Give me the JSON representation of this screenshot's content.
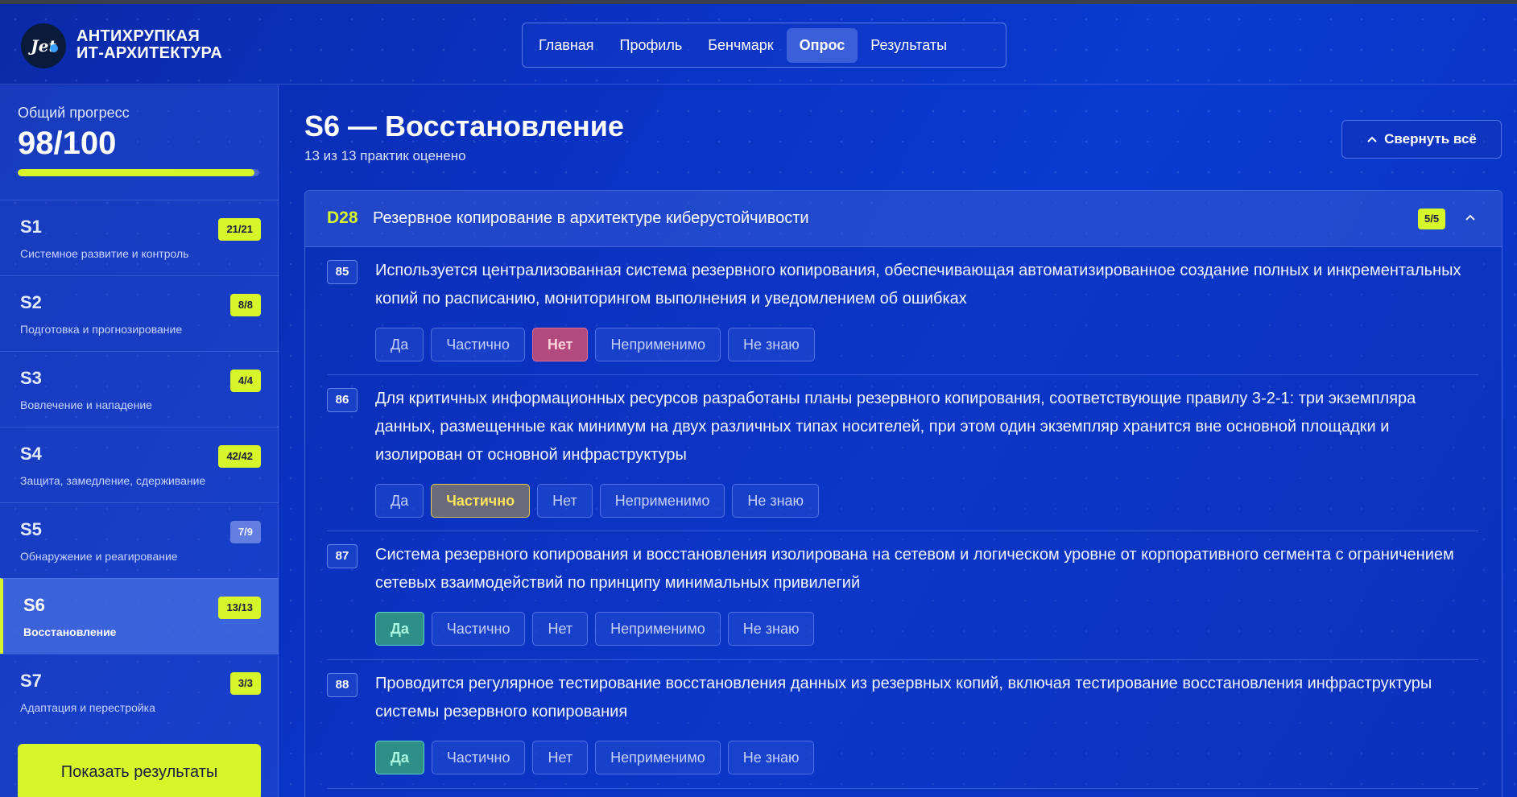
{
  "brand": {
    "logo_text": "Jet",
    "line1": "АНТИХРУПКАЯ",
    "line2": "ИТ-АРХИТЕКТУРА"
  },
  "nav": {
    "items": [
      {
        "label": "Главная",
        "active": false
      },
      {
        "label": "Профиль",
        "active": false
      },
      {
        "label": "Бенчмарк",
        "active": false
      },
      {
        "label": "Опрос",
        "active": true
      },
      {
        "label": "Результаты",
        "active": false
      }
    ]
  },
  "sidebar": {
    "progress_label": "Общий прогресс",
    "progress_value": "98/100",
    "progress_fraction": 0.98,
    "sections": [
      {
        "code": "S1",
        "name": "Системное развитие и контроль",
        "badge": "21/21",
        "complete": true,
        "active": false
      },
      {
        "code": "S2",
        "name": "Подготовка и прогнозирование",
        "badge": "8/8",
        "complete": true,
        "active": false
      },
      {
        "code": "S3",
        "name": "Вовлечение и нападение",
        "badge": "4/4",
        "complete": true,
        "active": false
      },
      {
        "code": "S4",
        "name": "Защита, замедление, сдерживание",
        "badge": "42/42",
        "complete": true,
        "active": false
      },
      {
        "code": "S5",
        "name": "Обнаружение и реагирование",
        "badge": "7/9",
        "complete": false,
        "active": false
      },
      {
        "code": "S6",
        "name": "Восстановление",
        "badge": "13/13",
        "complete": true,
        "active": true
      },
      {
        "code": "S7",
        "name": "Адаптация и перестройка",
        "badge": "3/3",
        "complete": true,
        "active": false
      }
    ],
    "show_results_label": "Показать результаты"
  },
  "main": {
    "title": "S6 — Восстановление",
    "subtitle": "13 из 13 практик оценено",
    "collapse_label": "Свернуть всё",
    "card": {
      "code": "D28",
      "title": "Резервное копирование в архитектуре киберустойчивости",
      "badge": "5/5",
      "option_labels": [
        "Да",
        "Частично",
        "Нет",
        "Неприменимо",
        "Не знаю"
      ],
      "questions": [
        {
          "num": "85",
          "text": "Используется централизованная система резервного копирования, обеспечивающая автоматизированное создание полных и инкрементальных копий по расписанию, мониторингом выполнения и уведомлением об ошибках",
          "selected": "Нет"
        },
        {
          "num": "86",
          "text": "Для критичных информационных ресурсов разработаны планы резервного копирования, соответствующие правилу 3-2-1: три экземпляра данных, размещенные как минимум на двух различных типах носителей, при этом один экземпляр хранится вне основной площадки и изолирован от основной инфраструктуры",
          "selected": "Частично"
        },
        {
          "num": "87",
          "text": "Система резервного копирования и восстановления изолирована на сетевом и логическом уровне от корпоративного сегмента с ограничением сетевых взаимодействий по принципу минимальных привилегий",
          "selected": "Да"
        },
        {
          "num": "88",
          "text": "Проводится регулярное тестирование восстановления данных из резервных копий, включая тестирование восстановления инфраструктуры системы резервного копирования",
          "selected": "Да"
        }
      ]
    }
  },
  "colors": {
    "accent": "#d6f52b",
    "background": "#0a33c4",
    "selected_yes": "#2e8f88",
    "selected_partial": "#e8c847",
    "selected_no": "#b34a7e"
  },
  "icons": {
    "collapse": "chevron-up-icon",
    "card_toggle": "chevron-up-icon"
  }
}
